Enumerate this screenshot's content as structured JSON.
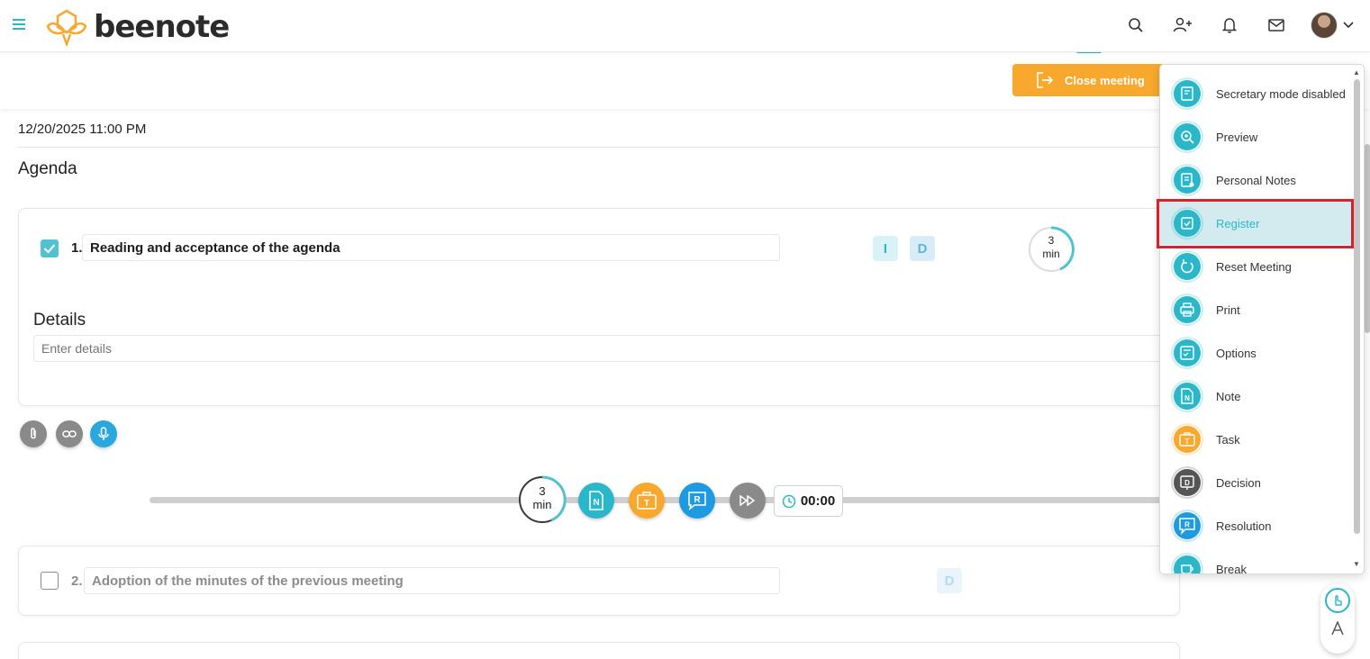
{
  "header": {
    "logo_text": "beenote",
    "icons": [
      "hamburger-icon",
      "search-icon",
      "add-user-icon",
      "bell-icon",
      "mail-icon",
      "avatar",
      "chevron-down-icon"
    ]
  },
  "actionbar": {
    "close_meeting_label": "Close meeting"
  },
  "meeting": {
    "date": "12/20/2025 11:00 PM",
    "agenda_title": "Agenda"
  },
  "items": [
    {
      "number": "1.",
      "title": "Reading and acceptance of the agenda",
      "checked": true,
      "tags": [
        "I",
        "D"
      ],
      "duration_value": "3",
      "duration_unit": "min",
      "details_label": "Details",
      "details_placeholder": "Enter details"
    },
    {
      "number": "2.",
      "title": "Adoption of the minutes of the previous meeting",
      "checked": false,
      "tags": [
        "D"
      ]
    }
  ],
  "progress": {
    "duration_value": "3",
    "duration_unit": "min",
    "elapsed": "00:00",
    "buttons": [
      "N",
      "T",
      "R"
    ]
  },
  "menu": {
    "items": [
      {
        "label": "Secretary mode disabled",
        "icon": "secretary-icon",
        "color": "#2ab7c9"
      },
      {
        "label": "Preview",
        "icon": "zoom-in-icon",
        "color": "#2ab7c9"
      },
      {
        "label": "Personal Notes",
        "icon": "personal-notes-icon",
        "color": "#2ab7c9"
      },
      {
        "label": "Register",
        "icon": "register-icon",
        "color": "#2ab7c9",
        "active": true
      },
      {
        "label": "Reset Meeting",
        "icon": "reset-icon",
        "color": "#2ab7c9"
      },
      {
        "label": "Print",
        "icon": "print-icon",
        "color": "#2ab7c9"
      },
      {
        "label": "Options",
        "icon": "options-icon",
        "color": "#2ab7c9"
      },
      {
        "label": "Note",
        "icon": "note-icon",
        "color": "#2ab7c9"
      },
      {
        "label": "Task",
        "icon": "task-icon",
        "color": "#f7a82d"
      },
      {
        "label": "Decision",
        "icon": "decision-icon",
        "color": "#555555"
      },
      {
        "label": "Resolution",
        "icon": "resolution-icon",
        "color": "#1e9be0"
      },
      {
        "label": "Break",
        "icon": "break-icon",
        "color": "#2ab7c9"
      }
    ]
  },
  "colors": {
    "accent": "#2ab7c9",
    "orange": "#f7a82d",
    "blue": "#1e9be0",
    "grey": "#8a8a8a",
    "highlight": "#d9212e"
  }
}
